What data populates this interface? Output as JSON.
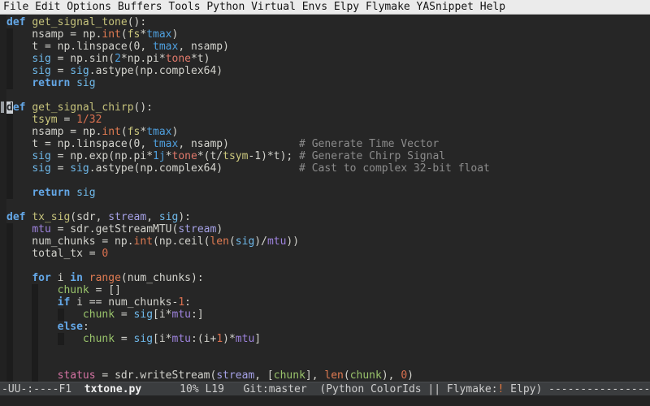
{
  "menu": {
    "items": [
      "File",
      "Edit",
      "Options",
      "Buffers",
      "Tools",
      "Python",
      "Virtual Envs",
      "Elpy",
      "Flymake",
      "YASnippet",
      "Help"
    ]
  },
  "palette": {
    "fg": "#D3D3CD",
    "kw": "#64A8E8",
    "fn": "#C5C27B",
    "bi": "#E07B52",
    "cm": "#8C8C8C",
    "yl": "#CDC97E",
    "bl": "#4FA0DF",
    "lb": "#6FB9EA",
    "sa": "#E0796B",
    "pu": "#A5A1E6",
    "pu2": "#9E83DE",
    "gr": "#99C36B",
    "pk": "#D573A3",
    "nu": "#DC7150",
    "ml": "#CCCCCC",
    "mlb": "#F0F0F0",
    "warn": "#E6793F",
    "cursor_bg": "#CBCFD4",
    "cursor_fg": "#24282B",
    "editor_bg": "#262626",
    "menubar_bg": "#EBEBEB",
    "modeline_bg": "#3B3D3F"
  },
  "code": {
    "lines": [
      [
        [
          "kw",
          "def"
        ],
        [
          "fg",
          " "
        ],
        [
          "fn",
          "get_signal_tone"
        ],
        [
          "fg",
          "():"
        ]
      ],
      [
        [
          "fg",
          "    nsamp = np."
        ],
        [
          "bi",
          "int"
        ],
        [
          "fg",
          "("
        ],
        [
          "yl",
          "fs"
        ],
        [
          "fg",
          "*"
        ],
        [
          "bl",
          "tmax"
        ],
        [
          "fg",
          ")"
        ]
      ],
      [
        [
          "fg",
          "    t = np.linspace(0, "
        ],
        [
          "bl",
          "tmax"
        ],
        [
          "fg",
          ", nsamp)"
        ]
      ],
      [
        [
          "fg",
          "    "
        ],
        [
          "lb",
          "sig"
        ],
        [
          "fg",
          " = np.sin("
        ],
        [
          "bl",
          "2"
        ],
        [
          "fg",
          "*np.pi*"
        ],
        [
          "sa",
          "tone"
        ],
        [
          "fg",
          "*t)"
        ]
      ],
      [
        [
          "fg",
          "    "
        ],
        [
          "lb",
          "sig"
        ],
        [
          "fg",
          " = "
        ],
        [
          "lb",
          "sig"
        ],
        [
          "fg",
          ".astype(np.complex64)"
        ]
      ],
      [
        [
          "fg",
          "    "
        ],
        [
          "kw",
          "return"
        ],
        [
          "fg",
          " "
        ],
        [
          "lb",
          "sig"
        ]
      ],
      [],
      [
        [
          "cur",
          "d"
        ],
        [
          "kw",
          "ef"
        ],
        [
          "fg",
          " "
        ],
        [
          "fn",
          "get_signal_chirp"
        ],
        [
          "fg",
          "():"
        ]
      ],
      [
        [
          "fg",
          "    "
        ],
        [
          "yl",
          "tsym"
        ],
        [
          "fg",
          " = "
        ],
        [
          "nu",
          "1/32"
        ]
      ],
      [
        [
          "fg",
          "    nsamp = np."
        ],
        [
          "bi",
          "int"
        ],
        [
          "fg",
          "("
        ],
        [
          "yl",
          "fs"
        ],
        [
          "fg",
          "*"
        ],
        [
          "bl",
          "tmax"
        ],
        [
          "fg",
          ")"
        ]
      ],
      [
        [
          "fg",
          "    t = np.linspace(0, "
        ],
        [
          "bl",
          "tmax"
        ],
        [
          "fg",
          ", nsamp)           "
        ],
        [
          "cm",
          "# Generate Time Vector"
        ]
      ],
      [
        [
          "fg",
          "    "
        ],
        [
          "lb",
          "sig"
        ],
        [
          "fg",
          " = np.exp(np.pi*"
        ],
        [
          "bl",
          "1j"
        ],
        [
          "fg",
          "*"
        ],
        [
          "sa",
          "tone"
        ],
        [
          "fg",
          "*(t/"
        ],
        [
          "yl",
          "tsym"
        ],
        [
          "fg",
          "-1)*t); "
        ],
        [
          "cm",
          "# Generate Chirp Signal"
        ]
      ],
      [
        [
          "fg",
          "    "
        ],
        [
          "lb",
          "sig"
        ],
        [
          "fg",
          " = "
        ],
        [
          "lb",
          "sig"
        ],
        [
          "fg",
          ".astype(np.complex64)            "
        ],
        [
          "cm",
          "# Cast to complex 32-bit float"
        ]
      ],
      [],
      [
        [
          "fg",
          "    "
        ],
        [
          "kw",
          "return"
        ],
        [
          "fg",
          " "
        ],
        [
          "lb",
          "sig"
        ]
      ],
      [],
      [
        [
          "kw",
          "def"
        ],
        [
          "fg",
          " "
        ],
        [
          "fn",
          "tx_sig"
        ],
        [
          "fg",
          "(sdr, "
        ],
        [
          "pu",
          "stream"
        ],
        [
          "fg",
          ", "
        ],
        [
          "lb",
          "sig"
        ],
        [
          "fg",
          "):"
        ]
      ],
      [
        [
          "fg",
          "    "
        ],
        [
          "pu2",
          "mtu"
        ],
        [
          "fg",
          " = sdr.getStreamMTU("
        ],
        [
          "pu",
          "stream"
        ],
        [
          "fg",
          ")"
        ]
      ],
      [
        [
          "fg",
          "    num_chunks = np."
        ],
        [
          "bi",
          "int"
        ],
        [
          "fg",
          "(np.ceil("
        ],
        [
          "bi",
          "len"
        ],
        [
          "fg",
          "("
        ],
        [
          "lb",
          "sig"
        ],
        [
          "fg",
          ")/"
        ],
        [
          "pu2",
          "mtu"
        ],
        [
          "fg",
          "))"
        ]
      ],
      [
        [
          "fg",
          "    total_tx = "
        ],
        [
          "nu",
          "0"
        ]
      ],
      [],
      [
        [
          "fg",
          "    "
        ],
        [
          "kw",
          "for"
        ],
        [
          "fg",
          " i "
        ],
        [
          "kw",
          "in"
        ],
        [
          "fg",
          " "
        ],
        [
          "bi",
          "range"
        ],
        [
          "fg",
          "(num_chunks):"
        ]
      ],
      [
        [
          "fg",
          "        "
        ],
        [
          "gr",
          "chunk"
        ],
        [
          "fg",
          " = []"
        ]
      ],
      [
        [
          "fg",
          "        "
        ],
        [
          "kw",
          "if"
        ],
        [
          "fg",
          " i == num_chunks-"
        ],
        [
          "nu",
          "1"
        ],
        [
          "fg",
          ":"
        ]
      ],
      [
        [
          "fg",
          "            "
        ],
        [
          "gr",
          "chunk"
        ],
        [
          "fg",
          " = "
        ],
        [
          "lb",
          "sig"
        ],
        [
          "fg",
          "[i*"
        ],
        [
          "pu2",
          "mtu"
        ],
        [
          "fg",
          ":]"
        ]
      ],
      [
        [
          "fg",
          "        "
        ],
        [
          "kw",
          "else"
        ],
        [
          "fg",
          ":"
        ]
      ],
      [
        [
          "fg",
          "            "
        ],
        [
          "gr",
          "chunk"
        ],
        [
          "fg",
          " = "
        ],
        [
          "lb",
          "sig"
        ],
        [
          "fg",
          "[i*"
        ],
        [
          "pu2",
          "mtu"
        ],
        [
          "fg",
          ":(i+"
        ],
        [
          "nu",
          "1"
        ],
        [
          "fg",
          ")*"
        ],
        [
          "pu2",
          "mtu"
        ],
        [
          "fg",
          "]"
        ]
      ],
      [],
      [],
      [
        [
          "fg",
          "        "
        ],
        [
          "pk",
          "status"
        ],
        [
          "fg",
          " = sdr.writeStream("
        ],
        [
          "pu",
          "stream"
        ],
        [
          "fg",
          ", ["
        ],
        [
          "gr",
          "chunk"
        ],
        [
          "fg",
          "], "
        ],
        [
          "bi",
          "len"
        ],
        [
          "fg",
          "("
        ],
        [
          "gr",
          "chunk"
        ],
        [
          "fg",
          "), "
        ],
        [
          "nu",
          "0"
        ],
        [
          "fg",
          ")"
        ]
      ]
    ]
  },
  "mode_line": {
    "segments": [
      {
        "text": "-UU-:----F1  ",
        "style": "ml",
        "name": "mode-line-prefix",
        "interactable": false
      },
      {
        "text": "txtone.py",
        "style": "mlb",
        "name": "buffer-name",
        "interactable": true
      },
      {
        "text": "      10% L19   ",
        "style": "ml",
        "name": "position-info",
        "interactable": false
      },
      {
        "text": "Git:master",
        "style": "ml",
        "name": "vc-branch",
        "interactable": true
      },
      {
        "text": "  (Python ColorIds || Flymake:",
        "style": "ml",
        "name": "minor-modes",
        "interactable": true
      },
      {
        "text": "!",
        "style": "warn",
        "name": "flymake-error-count",
        "interactable": true
      },
      {
        "text": " Elpy) ",
        "style": "ml",
        "name": "minor-modes-cont",
        "interactable": true
      },
      {
        "text": "--------------------",
        "style": "ml",
        "name": "mode-line-dashes",
        "interactable": false
      }
    ]
  }
}
